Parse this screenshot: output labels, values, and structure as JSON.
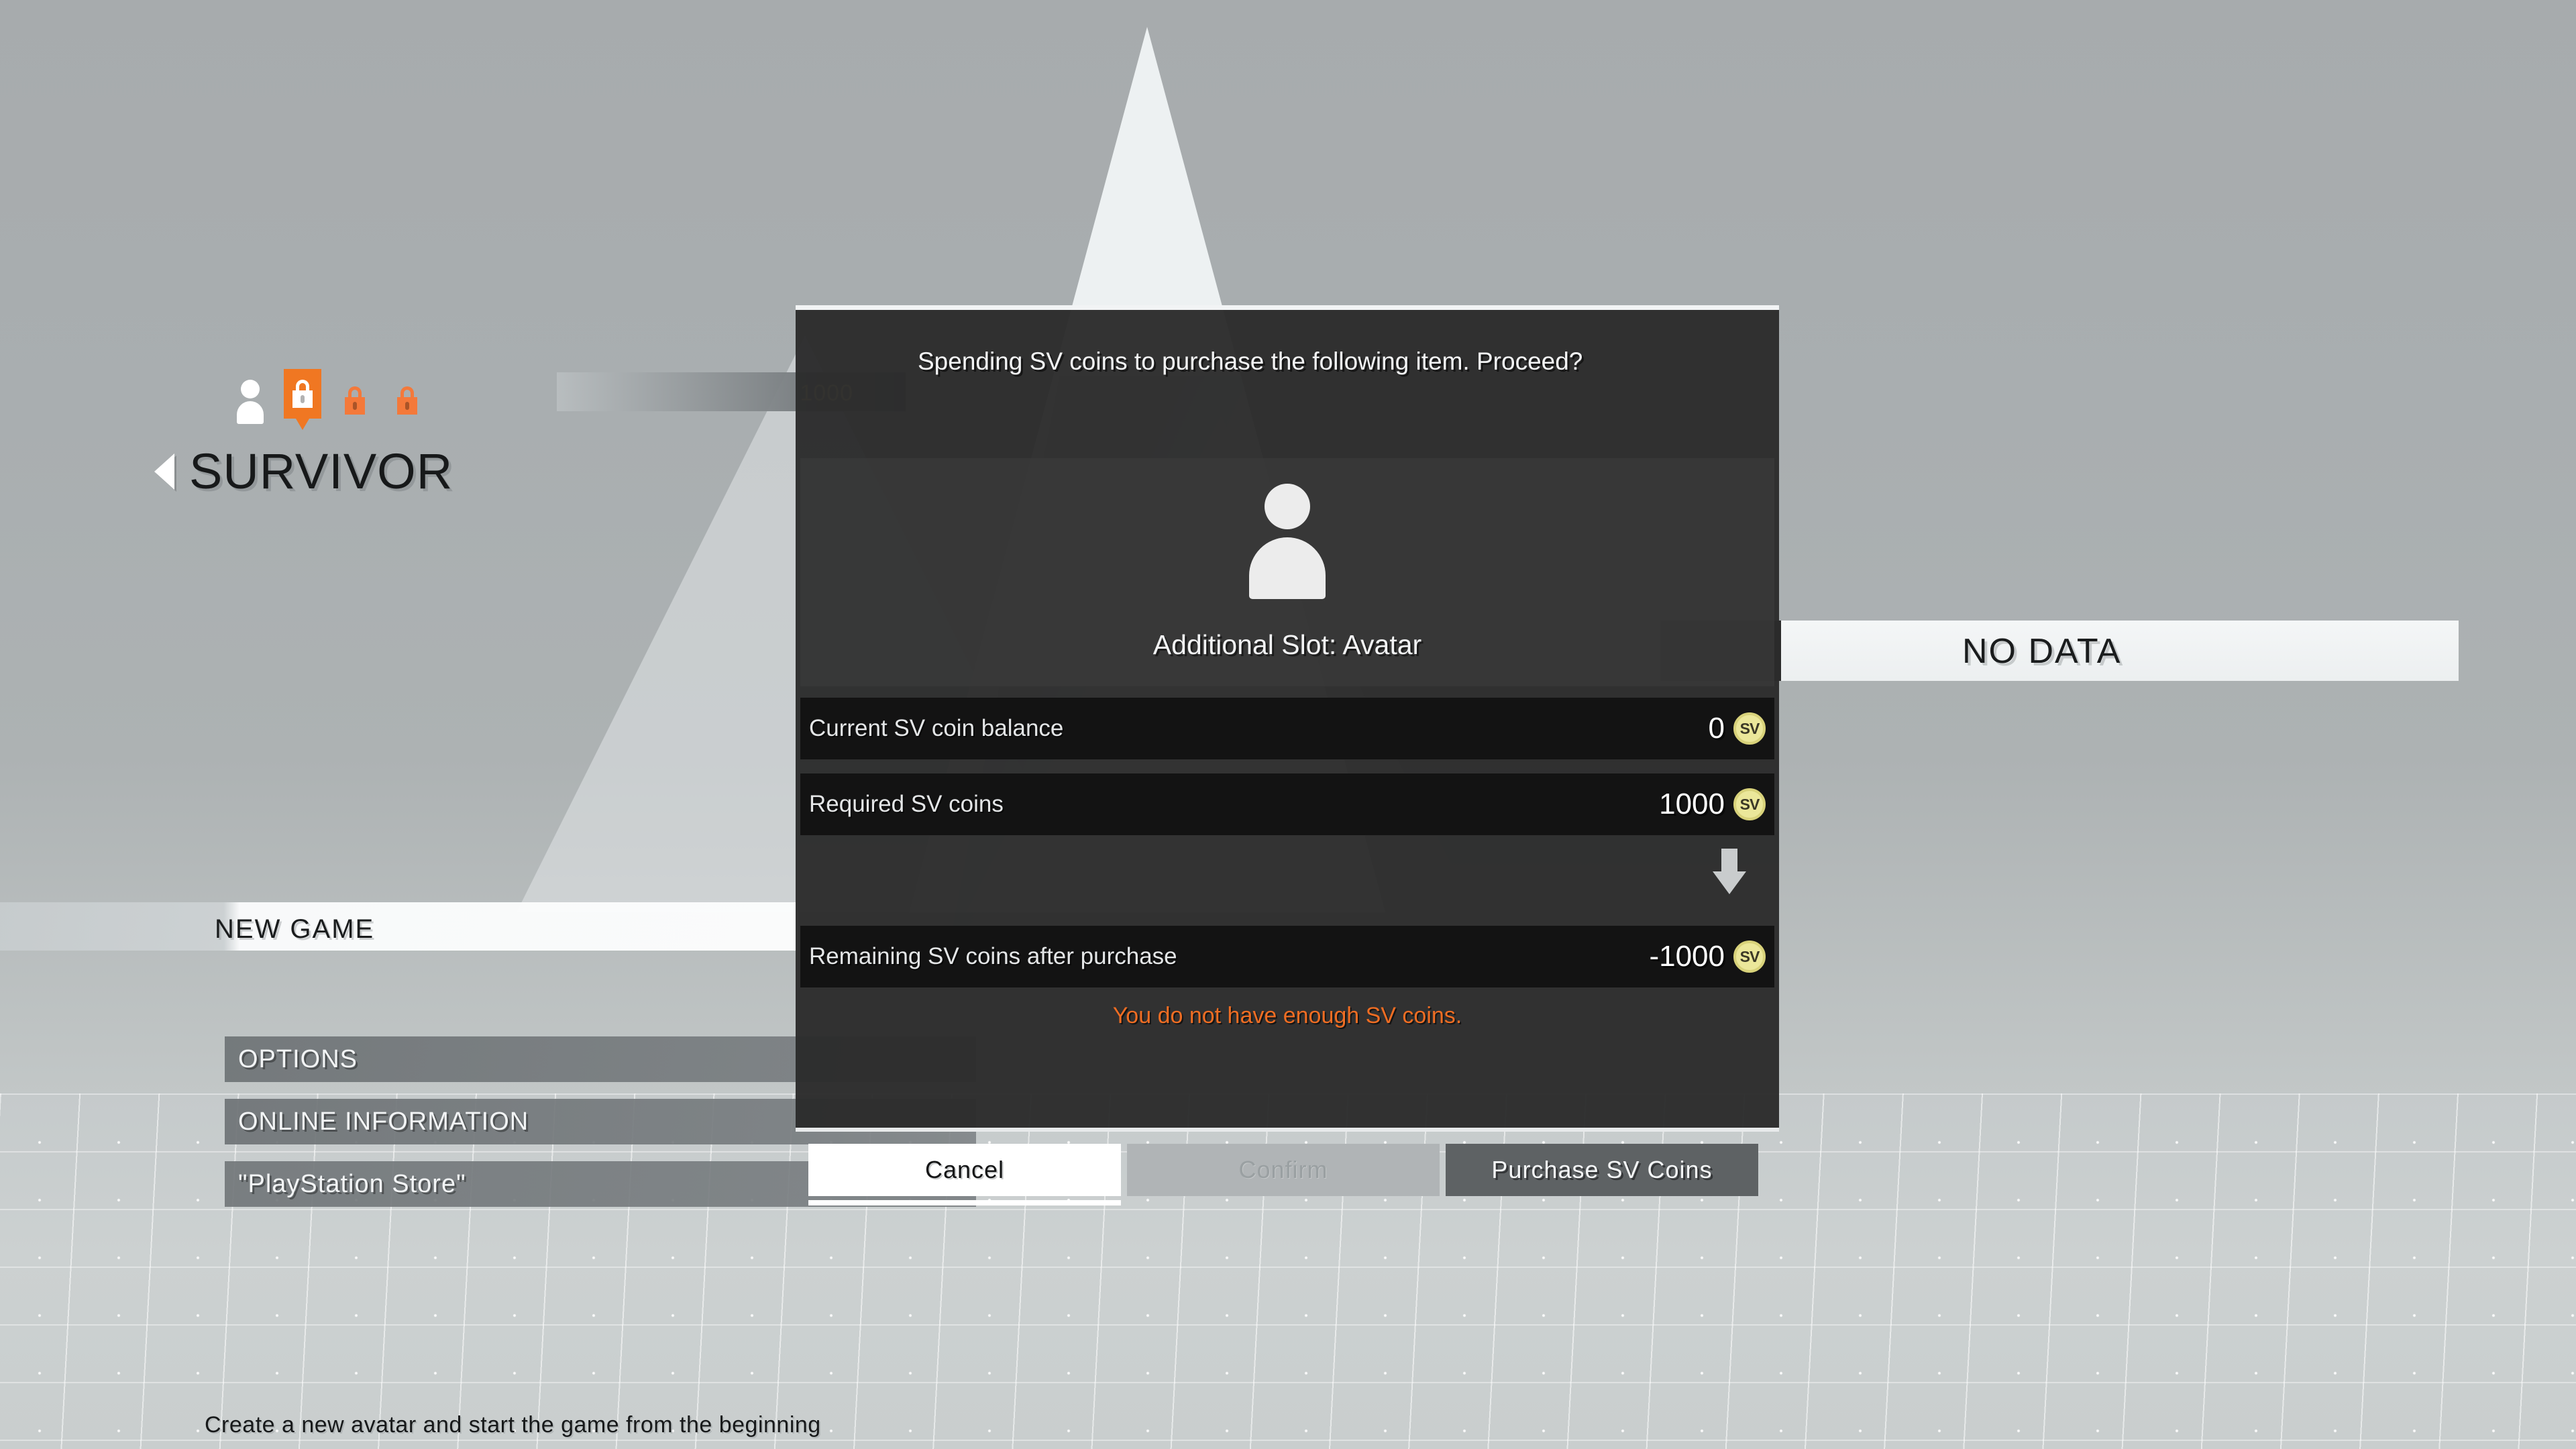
{
  "background": {
    "slot_icons": [
      {
        "name": "avatar-slot-filled",
        "type": "person",
        "state": "filled"
      },
      {
        "name": "avatar-slot-locked-selected",
        "type": "lock",
        "state": "selected"
      },
      {
        "name": "avatar-slot-locked-2",
        "type": "lock",
        "state": "locked"
      },
      {
        "name": "avatar-slot-locked-3",
        "type": "lock",
        "state": "locked"
      }
    ],
    "coin_bar_value": "1000",
    "coin_symbol": "SV",
    "screen_title": "SURVIVOR",
    "selected_entry": "NEW GAME",
    "menu_items": [
      {
        "label": "OPTIONS"
      },
      {
        "label": "ONLINE INFORMATION"
      },
      {
        "label": "\"PlayStation Store\""
      }
    ],
    "description": "Create a new avatar and start the game from the beginning",
    "no_data_label": "NO DATA"
  },
  "dialog": {
    "header": "Spending SV  coins to purchase the following item. Proceed?",
    "item_name": "Additional Slot: Avatar",
    "rows": [
      {
        "label": "Current SV  coin balance",
        "value": "0",
        "coin": "SV"
      },
      {
        "label": "Required SV  coins",
        "value": "1000",
        "coin": "SV"
      },
      {
        "label": "Remaining SV  coins after purchase",
        "value": "-1000",
        "coin": "SV"
      }
    ],
    "warning": "You do not have enough SV  coins.",
    "buttons": {
      "cancel": "Cancel",
      "confirm": "Confirm",
      "purchase": "Purchase SV  Coins"
    }
  },
  "colors": {
    "accent_orange": "#ef6d23",
    "lock_orange": "#f07722",
    "coin_yellow": "#ebe79a",
    "dialog_bg": "#2c2c2c",
    "row_bg": "#131313"
  }
}
